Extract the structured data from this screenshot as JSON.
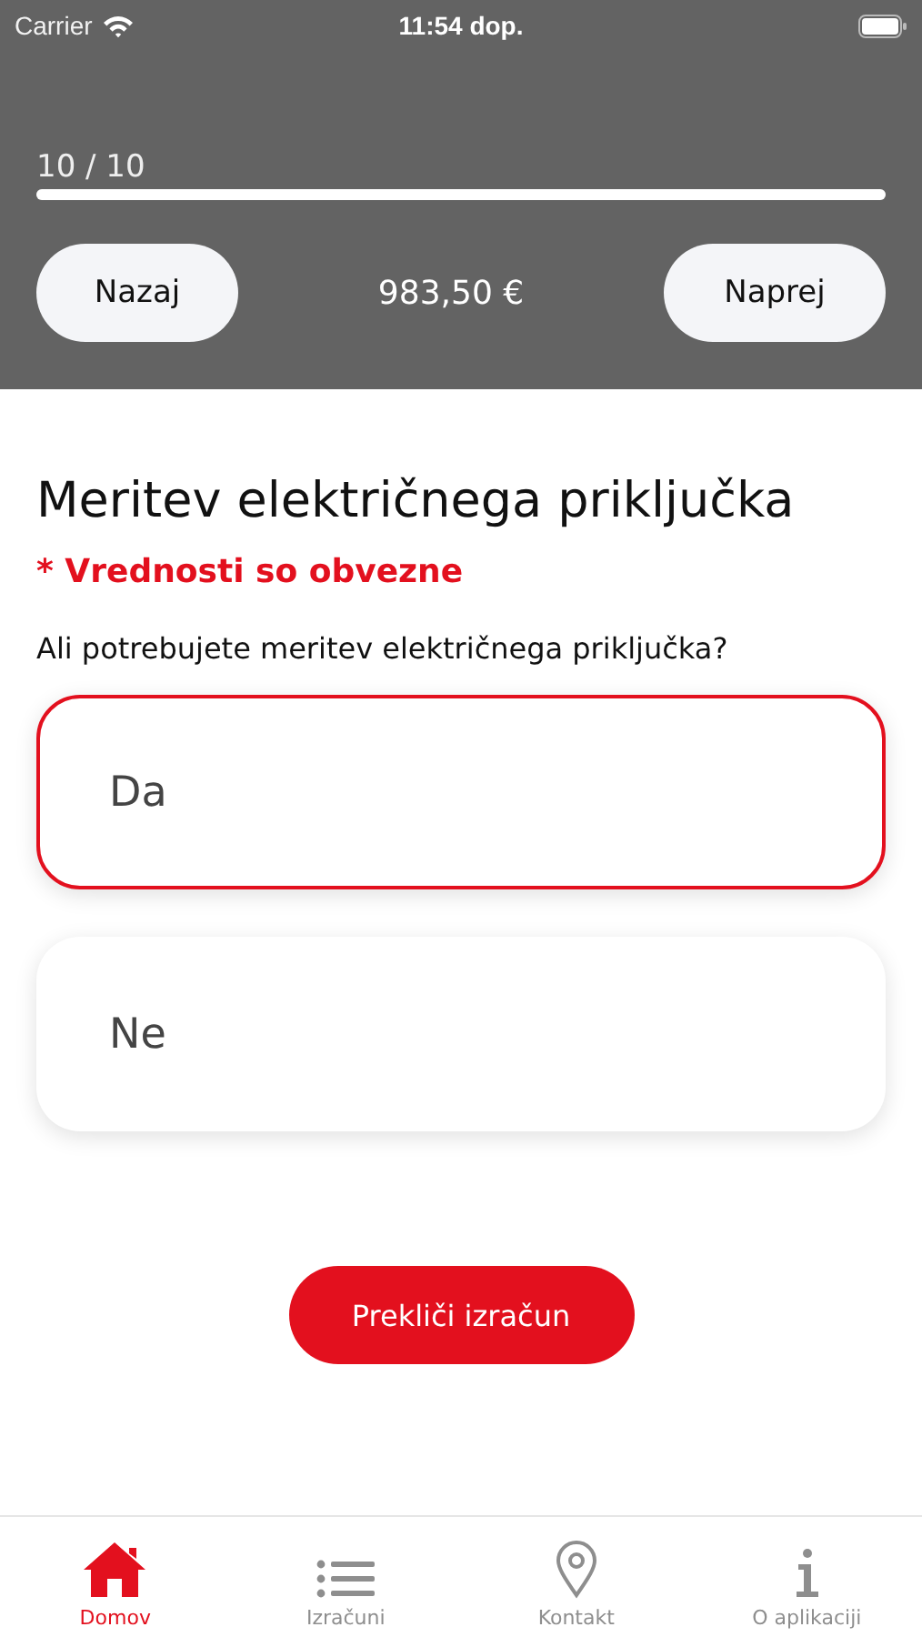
{
  "status_bar": {
    "carrier": "Carrier",
    "time": "11:54 dop."
  },
  "progress": {
    "label": "10 / 10",
    "level": 1.0
  },
  "nav": {
    "back": "Nazaj",
    "total": "983,50 €",
    "next": "Naprej"
  },
  "title": "Meritev električnega priključka",
  "required_note": "* Vrednosti so obvezne",
  "question": "Ali potrebujete meritev električnega priključka?",
  "options": [
    {
      "label": "Da",
      "selected": true
    },
    {
      "label": "Ne",
      "selected": false
    }
  ],
  "cancel_button": "Prekliči izračun",
  "tabs": [
    {
      "kind": "home",
      "label": "Domov",
      "selected": true
    },
    {
      "kind": "list",
      "label": "Izračuni",
      "selected": false
    },
    {
      "kind": "pin",
      "label": "Kontakt",
      "selected": false
    },
    {
      "kind": "info",
      "label": "O aplikaciji",
      "selected": false
    }
  ]
}
